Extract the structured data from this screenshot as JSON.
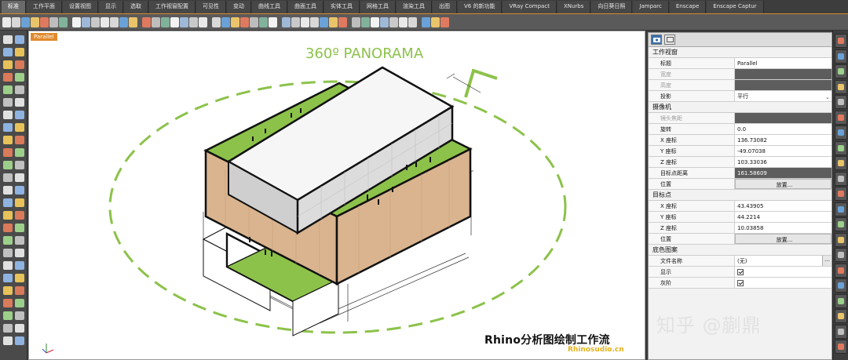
{
  "tabs": [
    "标准",
    "工作平面",
    "设置视图",
    "显示",
    "选取",
    "工作视窗配置",
    "可见性",
    "变动",
    "曲线工具",
    "曲面工具",
    "实体工具",
    "网格工具",
    "渲染工具",
    "出图",
    "V6 的新功能",
    "VRay Compact",
    "XNurbs",
    "向日葵日照",
    "Jamparc",
    "Enscape",
    "Enscape Captur"
  ],
  "active_tab": 0,
  "viewport": {
    "label": "Parallel",
    "title": "360º PANORAMA",
    "caption": "Rhino分析图绘制工作流",
    "caption_sub": "Rhinosudio.cn",
    "watermark": "知乎 @蒯鼎"
  },
  "colors": {
    "accent": "#e08a2c",
    "green": "#8cc24a",
    "dash": "#8cc24a",
    "wood": "#d9b48e",
    "panel_dark": "#5d5d5d"
  },
  "panel": {
    "sections": [
      {
        "title": "工作视窗",
        "rows": [
          {
            "k": "标题",
            "v": "Parallel",
            "kind": "text"
          },
          {
            "k": "宽度",
            "v": "",
            "kind": "dark",
            "dim": true
          },
          {
            "k": "高度",
            "v": "",
            "kind": "dark",
            "dim": true
          },
          {
            "k": "投影",
            "v": "平行",
            "kind": "dropdown"
          }
        ]
      },
      {
        "title": "摄像机",
        "rows": [
          {
            "k": "镜头焦距",
            "v": "",
            "kind": "dark",
            "dim": true
          },
          {
            "k": "旋转",
            "v": "0.0",
            "kind": "text"
          },
          {
            "k": "X 座标",
            "v": "136.73082",
            "kind": "text"
          },
          {
            "k": "Y 座标",
            "v": "-49.07038",
            "kind": "text"
          },
          {
            "k": "Z 座标",
            "v": "103.33036",
            "kind": "text"
          },
          {
            "k": "目标点距离",
            "v": "161.58609",
            "kind": "dark"
          },
          {
            "k": "位置",
            "v": "放置...",
            "kind": "button"
          }
        ]
      },
      {
        "title": "目标点",
        "rows": [
          {
            "k": "X 座标",
            "v": "43.43905",
            "kind": "text"
          },
          {
            "k": "Y 座标",
            "v": "44.2214",
            "kind": "text"
          },
          {
            "k": "Z 座标",
            "v": "10.03858",
            "kind": "text"
          },
          {
            "k": "位置",
            "v": "放置...",
            "kind": "button"
          }
        ]
      },
      {
        "title": "底色图案",
        "rows": [
          {
            "k": "文件名称",
            "v": "(无)",
            "kind": "file"
          },
          {
            "k": "显示",
            "v": "",
            "kind": "check"
          },
          {
            "k": "灰阶",
            "v": "",
            "kind": "check"
          }
        ]
      }
    ]
  }
}
